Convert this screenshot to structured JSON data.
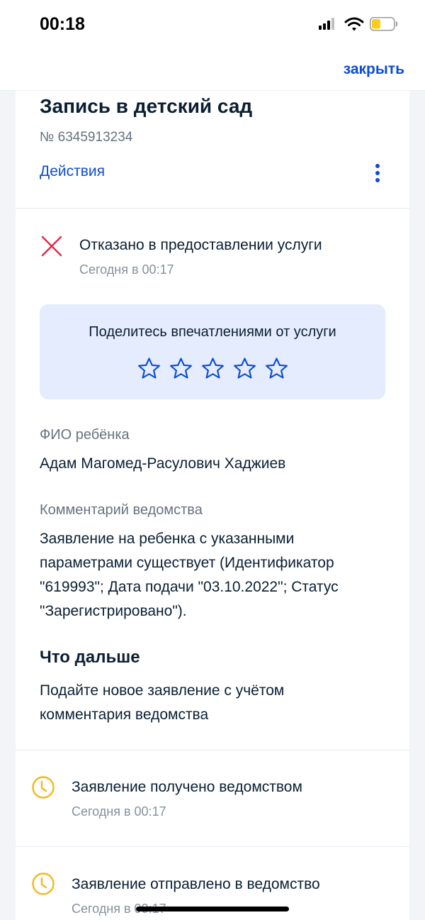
{
  "status_bar": {
    "time": "00:18"
  },
  "top_nav": {
    "close_label": "закрыть"
  },
  "order": {
    "title": "Запись в детский сад",
    "number": "№ 6345913234",
    "actions_label": "Действия"
  },
  "current_status": {
    "title": "Отказано в предоставлении услуги",
    "time": "Сегодня в 00:17",
    "icon": "cross-icon",
    "color": "#e0294a"
  },
  "feedback": {
    "title": "Поделитесь впечатлениями от услуги",
    "stars_total": 5,
    "stars_selected": 0,
    "accent": "#0d4cd3"
  },
  "child": {
    "label": "ФИО ребёнка",
    "value": "Адам Магомед-Расулович Хаджиев"
  },
  "comment": {
    "label": "Комментарий ведомства",
    "lines": [
      "Заявление на ребенка с указанными",
      "параметрами существует (Идентификатор",
      "\"619993\"; Дата подачи \"03.10.2022\"; Статус",
      "\"Зарегистрировано\")."
    ]
  },
  "next_steps": {
    "heading": "Что дальше",
    "lines": [
      "Подайте новое заявление с учётом",
      "комментария ведомства"
    ]
  },
  "history": [
    {
      "title": "Заявление получено ведомством",
      "time": "Сегодня в 00:17",
      "icon": "clock-icon"
    },
    {
      "title": "Заявление отправлено в ведомство",
      "time": "Сегодня в 00:17",
      "icon": "clock-icon"
    }
  ],
  "colors": {
    "link": "#0d4cd3",
    "pending": "#f4b81e",
    "error": "#e0294a",
    "feedback_bg": "#e4ecfd"
  }
}
